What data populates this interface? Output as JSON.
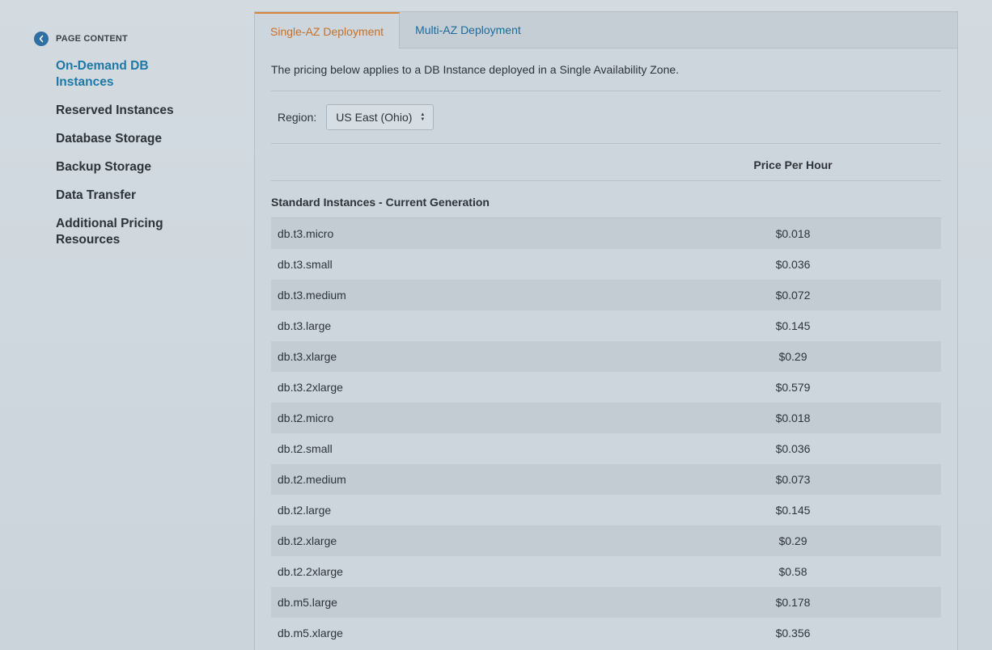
{
  "sidebar": {
    "header": "PAGE CONTENT",
    "back_icon": "chevron-left-icon",
    "items": [
      {
        "label": "On-Demand DB Instances"
      },
      {
        "label": "Reserved Instances"
      },
      {
        "label": "Database Storage"
      },
      {
        "label": "Backup Storage"
      },
      {
        "label": "Data Transfer"
      },
      {
        "label": "Additional Pricing Resources"
      }
    ]
  },
  "tabs": [
    {
      "label": "Single-AZ Deployment"
    },
    {
      "label": "Multi-AZ Deployment"
    }
  ],
  "intro": "The pricing below applies to a DB Instance deployed in a Single Availability Zone.",
  "region": {
    "label": "Region:",
    "selected": "US East (Ohio)"
  },
  "table": {
    "price_header": "Price Per Hour",
    "section_title": "Standard Instances - Current Generation",
    "rows": [
      {
        "name": "db.t3.micro",
        "price": "$0.018"
      },
      {
        "name": "db.t3.small",
        "price": "$0.036"
      },
      {
        "name": "db.t3.medium",
        "price": "$0.072"
      },
      {
        "name": "db.t3.large",
        "price": "$0.145"
      },
      {
        "name": "db.t3.xlarge",
        "price": "$0.29"
      },
      {
        "name": "db.t3.2xlarge",
        "price": "$0.579"
      },
      {
        "name": "db.t2.micro",
        "price": "$0.018"
      },
      {
        "name": "db.t2.small",
        "price": "$0.036"
      },
      {
        "name": "db.t2.medium",
        "price": "$0.073"
      },
      {
        "name": "db.t2.large",
        "price": "$0.145"
      },
      {
        "name": "db.t2.xlarge",
        "price": "$0.29"
      },
      {
        "name": "db.t2.2xlarge",
        "price": "$0.58"
      },
      {
        "name": "db.m5.large",
        "price": "$0.178"
      },
      {
        "name": "db.m5.xlarge",
        "price": "$0.356"
      }
    ]
  },
  "colors": {
    "active_link": "#1d78a8",
    "active_tab": "#c2722e",
    "inactive_tab": "#1d6b9c"
  }
}
